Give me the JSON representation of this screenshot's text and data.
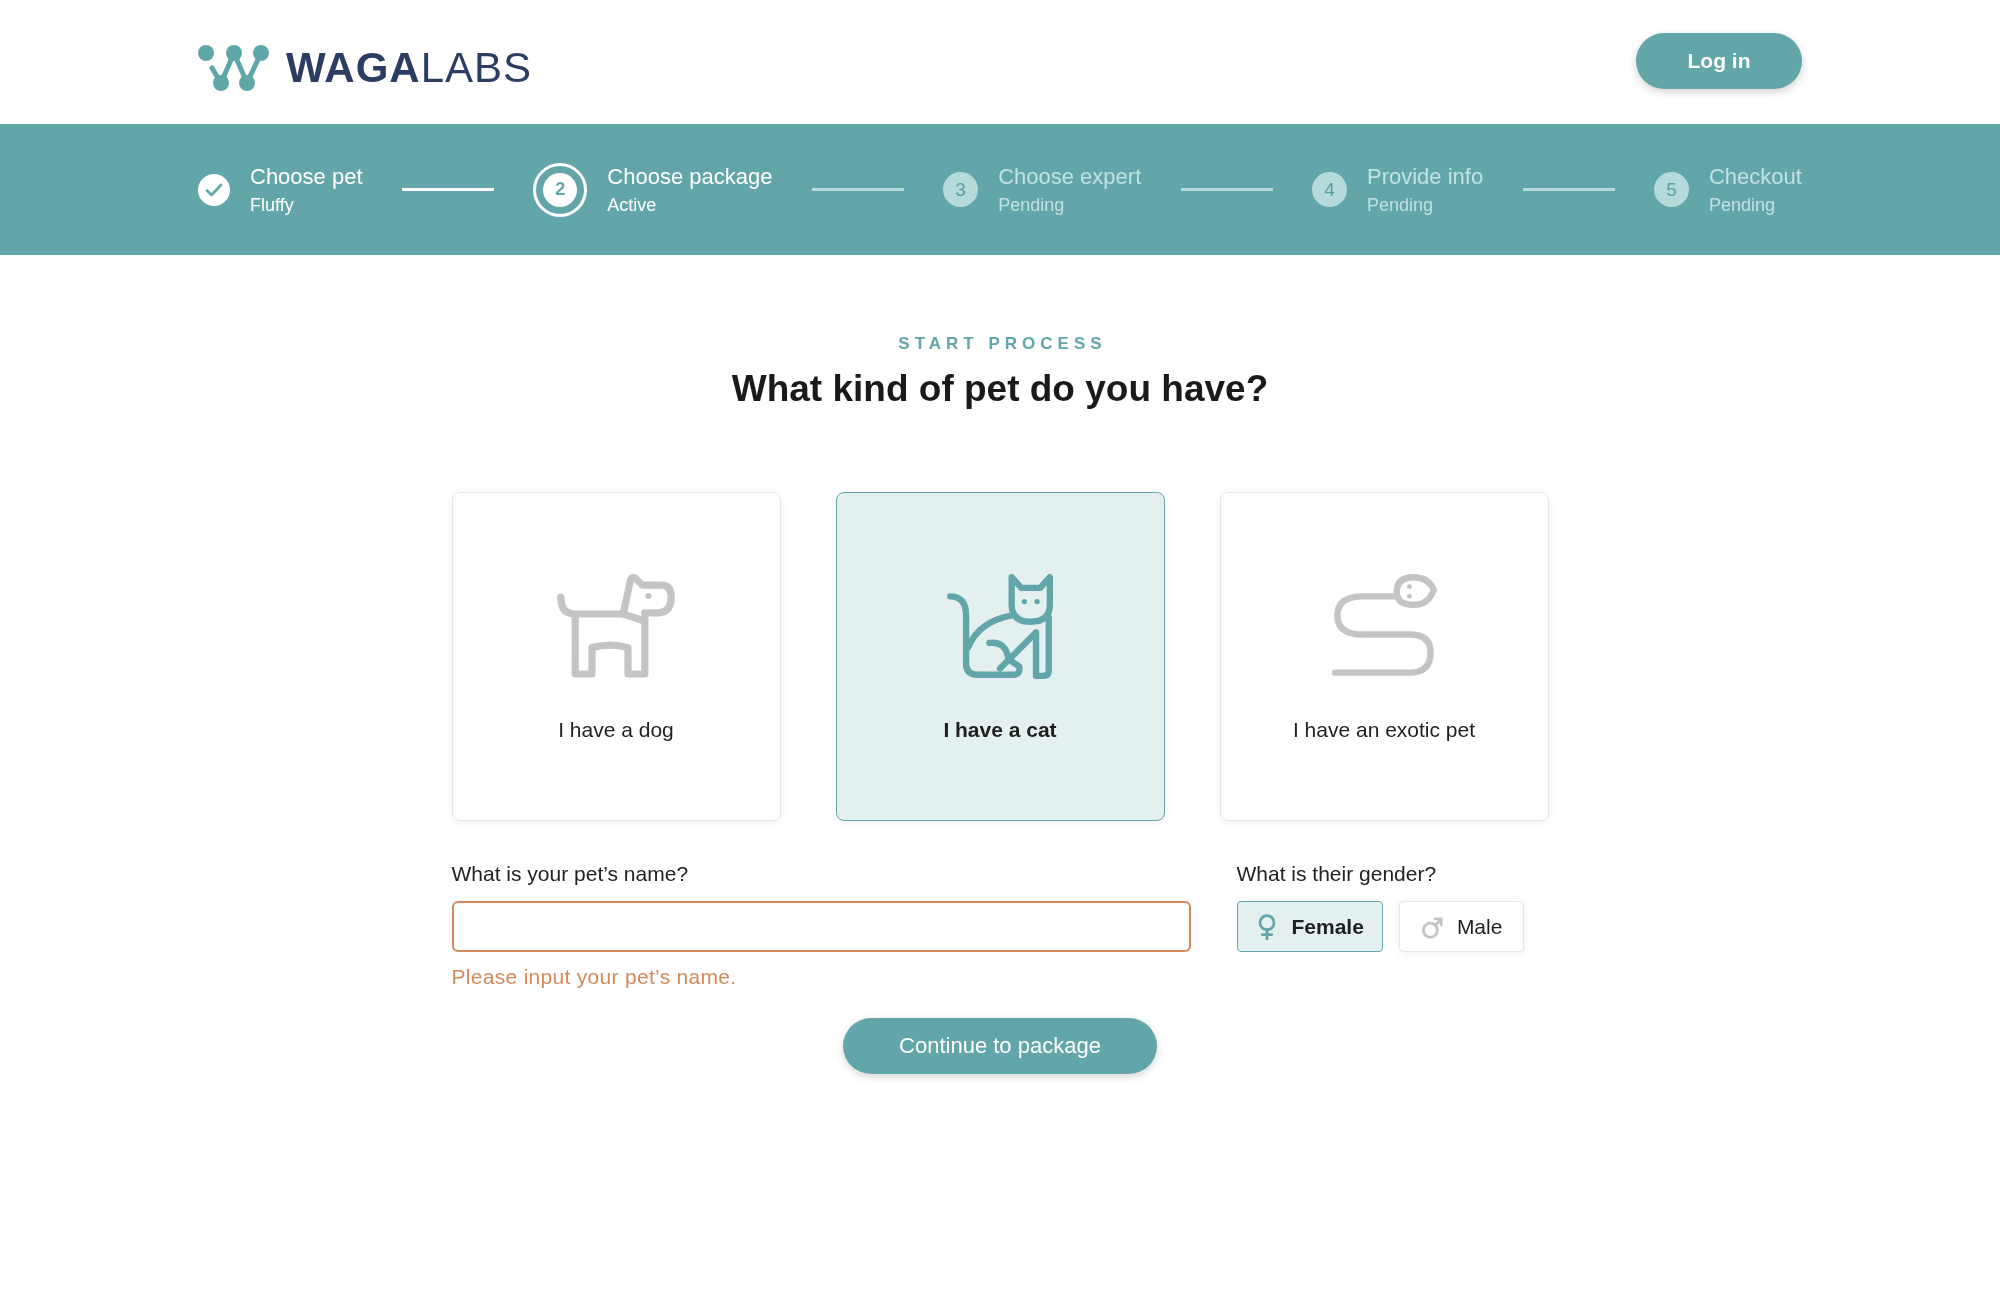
{
  "header": {
    "logo": "**WAGA**LABS",
    "login_button": "Log in"
  },
  "stepper": {
    "steps": [
      {
        "title": "Choose pet",
        "subtitle": "Fluffy",
        "completed": true,
        "selected": false
      },
      {
        "number": "2",
        "title": "Choose package",
        "subtitle": "Active",
        "completed": false,
        "selected": true
      },
      {
        "number": "3",
        "title": "Choose expert",
        "subtitle": "Pending",
        "completed": false,
        "selected": false
      },
      {
        "number": "4",
        "title": "Provide info",
        "subtitle": "Pending",
        "completed": false,
        "selected": false
      },
      {
        "number": "5",
        "title": "Checkout",
        "subtitle": "Pending",
        "completed": false,
        "selected": false
      }
    ]
  },
  "intro": {
    "eyebrow": "START PROCESS",
    "heading": "What kind of pet do you have?"
  },
  "pet_types": [
    {
      "kind": "dog",
      "label": "I have a dog",
      "selected": false
    },
    {
      "kind": "cat",
      "label": "I have a cat",
      "selected": true
    },
    {
      "kind": "snake",
      "label": "I have an exotic pet",
      "selected": false
    }
  ],
  "pet_name": {
    "label": "What is your pet’s name?",
    "error": "Please input your pet’s name."
  },
  "gender": {
    "label": "What is their gender?",
    "options": [
      {
        "kind": "female",
        "label": "Female",
        "selected": true
      },
      {
        "kind": "male",
        "label": "Male",
        "selected": false
      }
    ]
  },
  "continue_button": "Continue to package"
}
